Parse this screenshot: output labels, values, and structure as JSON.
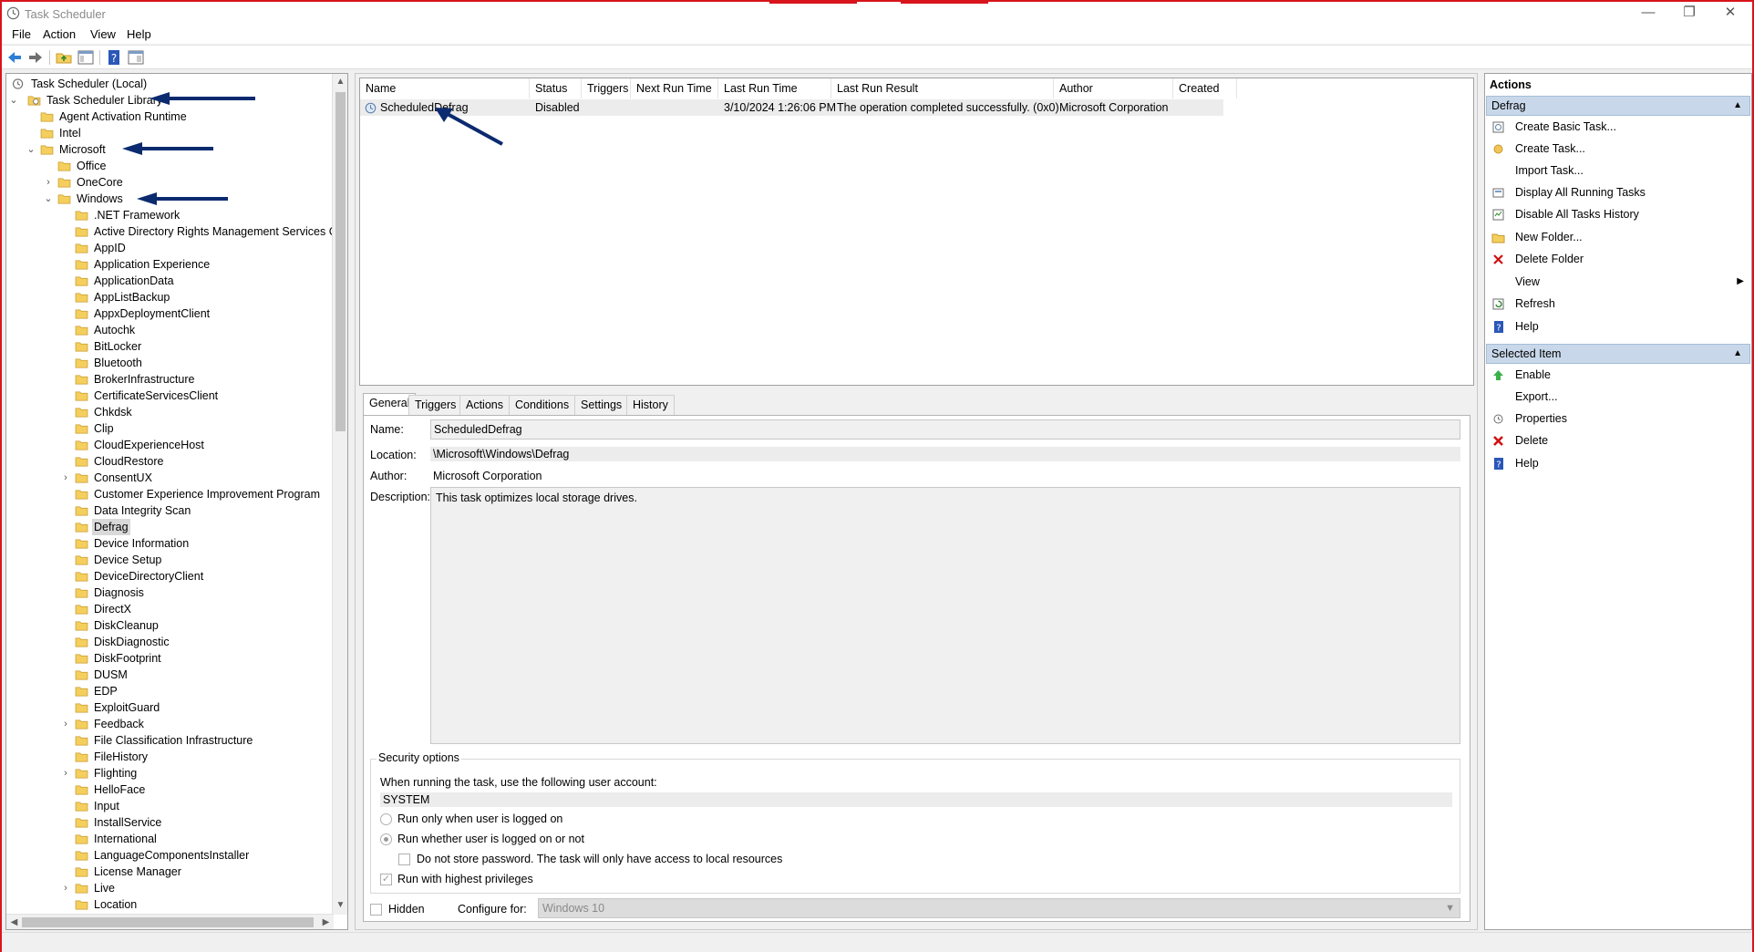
{
  "window": {
    "title": "Task Scheduler",
    "controls": {
      "minimize": "—",
      "restore": "❐",
      "close": "✕"
    }
  },
  "menu": [
    "File",
    "Action",
    "View",
    "Help"
  ],
  "toolbar_icons": [
    "back-icon",
    "forward-icon",
    "up-folder-icon",
    "show-hide-console-tree-icon",
    "help-icon",
    "show-hide-action-pane-icon"
  ],
  "tree": [
    {
      "label": "Task Scheduler (Local)",
      "level": 0,
      "expander": "",
      "icon": "clock"
    },
    {
      "label": "Task Scheduler Library",
      "level": 0,
      "expander": "⌄",
      "icon": "library"
    },
    {
      "label": "Agent Activation Runtime",
      "level": 1,
      "expander": "",
      "icon": "folder"
    },
    {
      "label": "Intel",
      "level": 1,
      "expander": "",
      "icon": "folder"
    },
    {
      "label": "Microsoft",
      "level": 1,
      "expander": "⌄",
      "icon": "folder"
    },
    {
      "label": "Office",
      "level": 2,
      "expander": "",
      "icon": "folder"
    },
    {
      "label": "OneCore",
      "level": 2,
      "expander": "›",
      "icon": "folder"
    },
    {
      "label": "Windows",
      "level": 2,
      "expander": "⌄",
      "icon": "folder"
    },
    {
      "label": ".NET Framework",
      "level": 3,
      "expander": "",
      "icon": "folder"
    },
    {
      "label": "Active Directory Rights Management Services Clie",
      "level": 3,
      "expander": "",
      "icon": "folder"
    },
    {
      "label": "AppID",
      "level": 3,
      "expander": "",
      "icon": "folder"
    },
    {
      "label": "Application Experience",
      "level": 3,
      "expander": "",
      "icon": "folder"
    },
    {
      "label": "ApplicationData",
      "level": 3,
      "expander": "",
      "icon": "folder"
    },
    {
      "label": "AppListBackup",
      "level": 3,
      "expander": "",
      "icon": "folder"
    },
    {
      "label": "AppxDeploymentClient",
      "level": 3,
      "expander": "",
      "icon": "folder"
    },
    {
      "label": "Autochk",
      "level": 3,
      "expander": "",
      "icon": "folder"
    },
    {
      "label": "BitLocker",
      "level": 3,
      "expander": "",
      "icon": "folder"
    },
    {
      "label": "Bluetooth",
      "level": 3,
      "expander": "",
      "icon": "folder"
    },
    {
      "label": "BrokerInfrastructure",
      "level": 3,
      "expander": "",
      "icon": "folder"
    },
    {
      "label": "CertificateServicesClient",
      "level": 3,
      "expander": "",
      "icon": "folder"
    },
    {
      "label": "Chkdsk",
      "level": 3,
      "expander": "",
      "icon": "folder"
    },
    {
      "label": "Clip",
      "level": 3,
      "expander": "",
      "icon": "folder"
    },
    {
      "label": "CloudExperienceHost",
      "level": 3,
      "expander": "",
      "icon": "folder"
    },
    {
      "label": "CloudRestore",
      "level": 3,
      "expander": "",
      "icon": "folder"
    },
    {
      "label": "ConsentUX",
      "level": 3,
      "expander": "›",
      "icon": "folder"
    },
    {
      "label": "Customer Experience Improvement Program",
      "level": 3,
      "expander": "",
      "icon": "folder"
    },
    {
      "label": "Data Integrity Scan",
      "level": 3,
      "expander": "",
      "icon": "folder"
    },
    {
      "label": "Defrag",
      "level": 3,
      "expander": "",
      "icon": "folder",
      "selected": true
    },
    {
      "label": "Device Information",
      "level": 3,
      "expander": "",
      "icon": "folder"
    },
    {
      "label": "Device Setup",
      "level": 3,
      "expander": "",
      "icon": "folder"
    },
    {
      "label": "DeviceDirectoryClient",
      "level": 3,
      "expander": "",
      "icon": "folder"
    },
    {
      "label": "Diagnosis",
      "level": 3,
      "expander": "",
      "icon": "folder"
    },
    {
      "label": "DirectX",
      "level": 3,
      "expander": "",
      "icon": "folder"
    },
    {
      "label": "DiskCleanup",
      "level": 3,
      "expander": "",
      "icon": "folder"
    },
    {
      "label": "DiskDiagnostic",
      "level": 3,
      "expander": "",
      "icon": "folder"
    },
    {
      "label": "DiskFootprint",
      "level": 3,
      "expander": "",
      "icon": "folder"
    },
    {
      "label": "DUSM",
      "level": 3,
      "expander": "",
      "icon": "folder"
    },
    {
      "label": "EDP",
      "level": 3,
      "expander": "",
      "icon": "folder"
    },
    {
      "label": "ExploitGuard",
      "level": 3,
      "expander": "",
      "icon": "folder"
    },
    {
      "label": "Feedback",
      "level": 3,
      "expander": "›",
      "icon": "folder"
    },
    {
      "label": "File Classification Infrastructure",
      "level": 3,
      "expander": "",
      "icon": "folder"
    },
    {
      "label": "FileHistory",
      "level": 3,
      "expander": "",
      "icon": "folder"
    },
    {
      "label": "Flighting",
      "level": 3,
      "expander": "›",
      "icon": "folder"
    },
    {
      "label": "HelloFace",
      "level": 3,
      "expander": "",
      "icon": "folder"
    },
    {
      "label": "Input",
      "level": 3,
      "expander": "",
      "icon": "folder"
    },
    {
      "label": "InstallService",
      "level": 3,
      "expander": "",
      "icon": "folder"
    },
    {
      "label": "International",
      "level": 3,
      "expander": "",
      "icon": "folder"
    },
    {
      "label": "LanguageComponentsInstaller",
      "level": 3,
      "expander": "",
      "icon": "folder"
    },
    {
      "label": "License Manager",
      "level": 3,
      "expander": "",
      "icon": "folder"
    },
    {
      "label": "Live",
      "level": 3,
      "expander": "›",
      "icon": "folder"
    },
    {
      "label": "Location",
      "level": 3,
      "expander": "",
      "icon": "folder"
    }
  ],
  "task_list": {
    "columns": [
      "Name",
      "Status",
      "Triggers",
      "Next Run Time",
      "Last Run Time",
      "Last Run Result",
      "Author",
      "Created"
    ],
    "rows": [
      {
        "Name": "ScheduledDefrag",
        "Status": "Disabled",
        "Triggers": "",
        "Next Run Time": "",
        "Last Run Time": "3/10/2024 1:26:06 PM",
        "Last Run Result": "The operation completed successfully. (0x0)",
        "Author": "Microsoft Corporation",
        "Created": ""
      }
    ]
  },
  "detail": {
    "tabs": [
      "General",
      "Triggers",
      "Actions",
      "Conditions",
      "Settings",
      "History"
    ],
    "active_tab": "General",
    "name_label": "Name:",
    "name_value": "ScheduledDefrag",
    "location_label": "Location:",
    "location_value": "\\Microsoft\\Windows\\Defrag",
    "author_label": "Author:",
    "author_value": "Microsoft Corporation",
    "description_label": "Description:",
    "description_value": "This task optimizes local storage drives.",
    "security": {
      "title": "Security options",
      "account_prompt": "When running the task, use the following user account:",
      "account": "SYSTEM",
      "opt_logged_on": "Run only when user is logged on",
      "opt_whether": "Run whether user is logged on or not",
      "opt_no_password": "Do not store password.  The task will only have access to local resources",
      "opt_highest": "Run with highest privileges",
      "selected_option": "opt_whether",
      "highest_checked": true,
      "no_password_checked": false
    },
    "hidden_label": "Hidden",
    "hidden_checked": false,
    "configure_label": "Configure for:",
    "configure_value": "Windows 10"
  },
  "actions": {
    "title": "Actions",
    "sections": [
      {
        "title": "Defrag",
        "items": [
          {
            "label": "Create Basic Task...",
            "icon": "create-basic-task-icon"
          },
          {
            "label": "Create Task...",
            "icon": "create-task-icon"
          },
          {
            "label": "Import Task...",
            "icon": ""
          },
          {
            "label": "Display All Running Tasks",
            "icon": "running-tasks-icon"
          },
          {
            "label": "Disable All Tasks History",
            "icon": "tasks-history-icon"
          },
          {
            "label": "New Folder...",
            "icon": "new-folder-icon"
          },
          {
            "label": "Delete Folder",
            "icon": "delete-folder-icon"
          },
          {
            "label": "View",
            "icon": "",
            "submenu": true
          },
          {
            "label": "Refresh",
            "icon": "refresh-icon"
          },
          {
            "label": "Help",
            "icon": "help-icon"
          }
        ]
      },
      {
        "title": "Selected Item",
        "items": [
          {
            "label": "Enable",
            "icon": "enable-icon"
          },
          {
            "label": "Export...",
            "icon": ""
          },
          {
            "label": "Properties",
            "icon": "properties-icon"
          },
          {
            "label": "Delete",
            "icon": "delete-icon"
          },
          {
            "label": "Help",
            "icon": "help-icon"
          }
        ]
      }
    ]
  },
  "colors": {
    "window_border": "#d8141c",
    "section_header": "#c8d8ea",
    "annotation_arrow": "#0b2a6f",
    "folder": "#f5cf5e"
  }
}
